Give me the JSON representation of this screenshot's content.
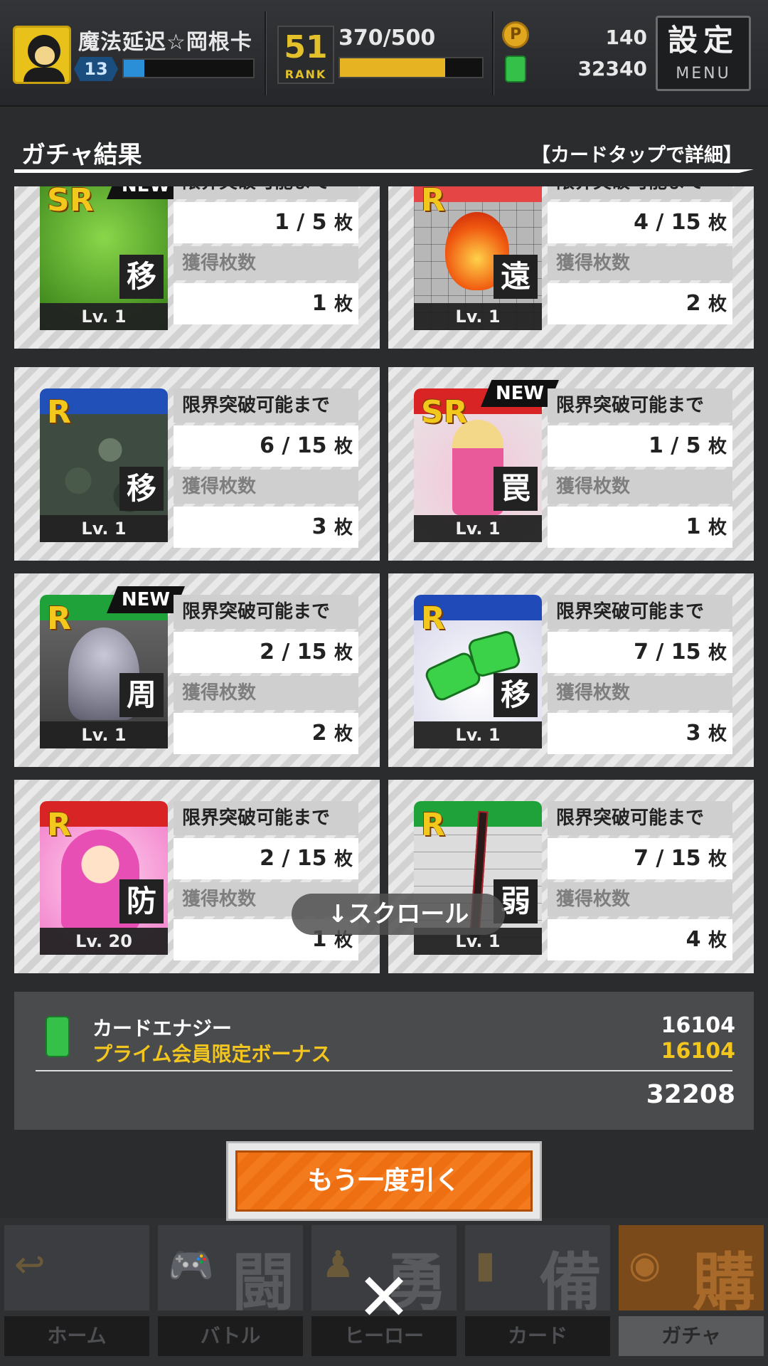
{
  "status": {
    "player_name": "魔法延迟☆岡根卡",
    "player_level": "13",
    "rank": "51",
    "rank_label": "RANK",
    "stamina": "370/500",
    "coins": "140",
    "energy": "32340",
    "menu_top": "設定",
    "menu_bottom": "MENU",
    "exp_fill": 0.16,
    "stamina_fill": 0.74
  },
  "results": {
    "title": "ガチャ結果",
    "hint": "【カードタップで詳細】",
    "limit_label": "限界突破可能まで",
    "obtained_label": "獲得枚数",
    "unit": "枚",
    "cards": [
      {
        "rarity": "SR",
        "is_new": true,
        "new_label": "NEW",
        "kanji": "移",
        "level": "Lv. 1",
        "progress": "1 / 5",
        "obtained": "1"
      },
      {
        "rarity": "R",
        "is_new": false,
        "new_label": "",
        "kanji": "遠",
        "level": "Lv. 1",
        "progress": "4 / 15",
        "obtained": "2"
      },
      {
        "rarity": "R",
        "is_new": false,
        "new_label": "",
        "kanji": "移",
        "level": "Lv. 1",
        "progress": "6 / 15",
        "obtained": "3"
      },
      {
        "rarity": "SR",
        "is_new": true,
        "new_label": "NEW",
        "kanji": "罠",
        "level": "Lv. 1",
        "progress": "1 / 5",
        "obtained": "1"
      },
      {
        "rarity": "R",
        "is_new": true,
        "new_label": "NEW",
        "kanji": "周",
        "level": "Lv. 1",
        "progress": "2 / 15",
        "obtained": "2"
      },
      {
        "rarity": "R",
        "is_new": false,
        "new_label": "",
        "kanji": "移",
        "level": "Lv. 1",
        "progress": "7 / 15",
        "obtained": "3"
      },
      {
        "rarity": "R",
        "is_new": false,
        "new_label": "",
        "kanji": "防",
        "level": "Lv. 20",
        "progress": "2 / 15",
        "obtained": "1"
      },
      {
        "rarity": "R",
        "is_new": false,
        "new_label": "",
        "kanji": "弱",
        "level": "Lv. 1",
        "progress": "7 / 15",
        "obtained": "4"
      }
    ],
    "scroll_hint": "↓スクロール"
  },
  "summary": {
    "energy_label": "カードエナジー",
    "bonus_label": "プライム会員限定ボーナス",
    "energy_value": "16104",
    "bonus_value": "16104",
    "total": "32208"
  },
  "draw_again": "もう一度引く",
  "nav": [
    {
      "label": "ホーム",
      "big": "",
      "icon": "home-icon"
    },
    {
      "label": "バトル",
      "big": "闘",
      "icon": "gamepad-icon"
    },
    {
      "label": "ヒーロー",
      "big": "勇",
      "icon": "hero-icon"
    },
    {
      "label": "カード",
      "big": "備",
      "icon": "cards-icon"
    },
    {
      "label": "ガチャ",
      "big": "購",
      "icon": "gacha-icon"
    }
  ],
  "close_symbol": "✕",
  "colors": {
    "accent_orange": "#f47a1e",
    "bonus_yellow": "#f3c51f",
    "energy_green": "#35c04a"
  }
}
